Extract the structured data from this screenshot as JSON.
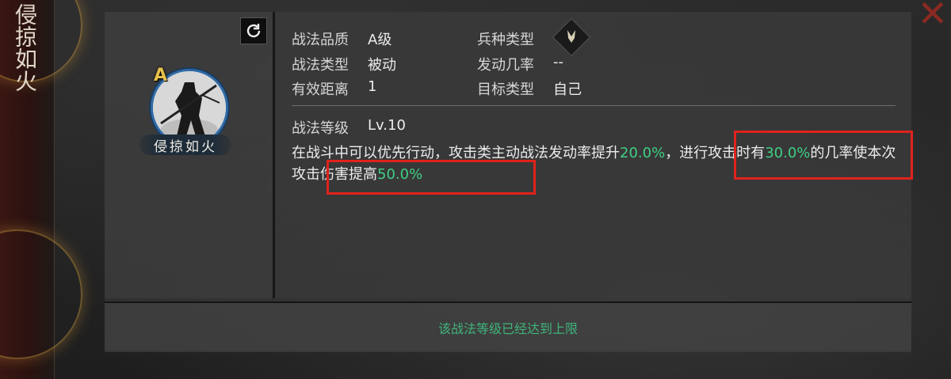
{
  "skill": {
    "vertical_title": "侵掠如火",
    "name": "侵掠如火",
    "grade_badge": "A"
  },
  "attributes": {
    "quality_label": "战法品质",
    "quality_value": "A级",
    "type_label": "战法类型",
    "type_value": "被动",
    "range_label": "有效距离",
    "range_value": "1",
    "troop_label": "兵种类型",
    "trigger_label": "发动几率",
    "trigger_value": "--",
    "target_label": "目标类型",
    "target_value": "自己",
    "level_label": "战法等级",
    "level_value": "Lv.10"
  },
  "description": {
    "part1": "在战斗中可以优先行动，攻击类主动战法发动率提升",
    "value1": "20.0%",
    "part2": "，进行攻击时有",
    "value2": "30.0%",
    "part3": "的几率使本次攻击伤害提高",
    "value3": "50.0%"
  },
  "footer": {
    "status_text": "该战法等级已经达到上限"
  },
  "icons": {
    "close": "close-icon",
    "refresh": "refresh-icon",
    "troop_type": "troop-type-icon"
  },
  "colors": {
    "highlight_green": "#3fcf84",
    "annotation_red": "#e0221c",
    "close_red": "#8a2a22",
    "avatar_ring_blue": "#2f6aa6"
  }
}
